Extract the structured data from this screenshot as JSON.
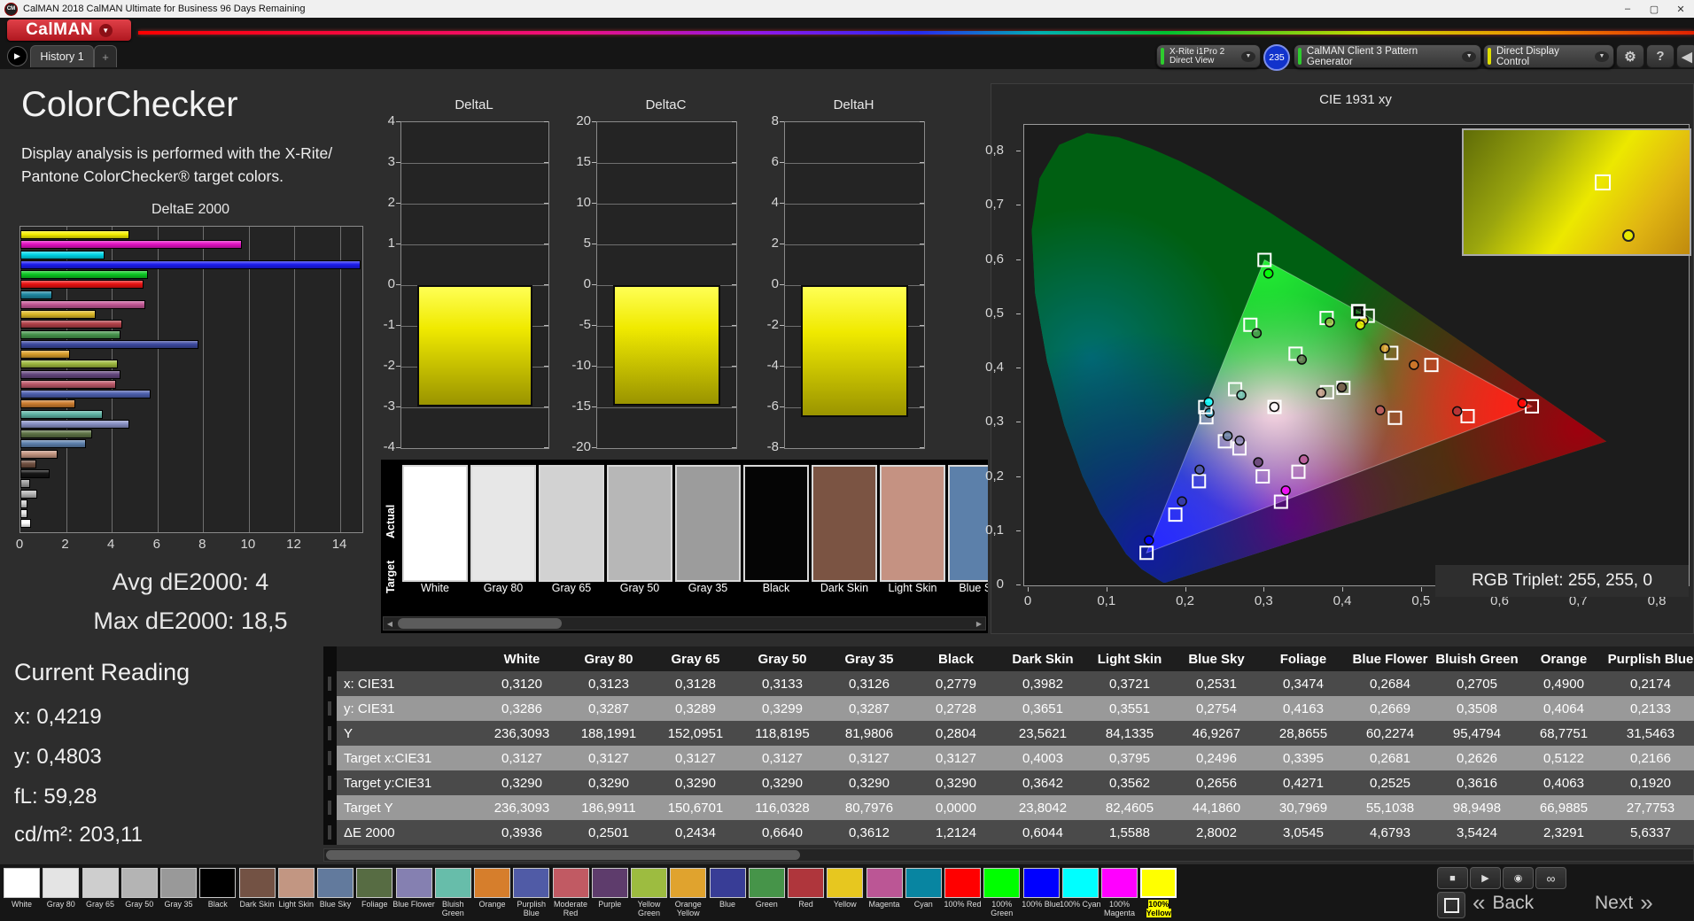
{
  "window": {
    "title": "CalMAN 2018 CalMAN Ultimate for Business 96 Days Remaining",
    "app_icon_text": "CM",
    "controls": {
      "minimize": "–",
      "maximize": "▢",
      "close": "✕"
    }
  },
  "branding": {
    "logo_text": "CalMAN",
    "logo_color": "#c01820"
  },
  "icons": {
    "play": "▶",
    "gear": "⚙",
    "collapse": "◀",
    "chevron_down": "▼",
    "plus": "+",
    "stop": "■",
    "measure": "◉",
    "infinity": "∞",
    "back_chevron": "«",
    "next_chevron": "»",
    "scroll_left": "◀",
    "scroll_right": "▶"
  },
  "tabs": {
    "history_tab": "History 1",
    "add_tab": "+"
  },
  "toolbar": {
    "meter": {
      "line1": "X-Rite i1Pro 2",
      "line2": "Direct View",
      "badge": "235",
      "status_color": "#2ecc2e"
    },
    "source": {
      "label": "CalMAN Client 3 Pattern Generator",
      "status_color": "#2ecc2e"
    },
    "display_control": {
      "label": "Direct Display Control",
      "status_color": "#e0e000"
    },
    "help_label": "?"
  },
  "left_panel": {
    "title": "ColorChecker",
    "description_line1": "Display analysis is performed with the X-Rite/",
    "description_line2": "Pantone ColorChecker® target colors.",
    "avg_label": "Avg dE2000: 4",
    "max_label": "Max dE2000: 18,5",
    "current_reading": {
      "title": "Current Reading",
      "x": "x: 0,4219",
      "y": "y: 0,4803",
      "fl": "fL: 59,28",
      "cdm2": "cd/m²: 203,11"
    }
  },
  "chart_data": [
    {
      "type": "bar",
      "orientation": "horizontal",
      "title": "DeltaE 2000",
      "xlim": [
        0,
        14
      ],
      "x_tick_labels": [
        "0",
        "2",
        "4",
        "6",
        "8",
        "10",
        "12",
        "14"
      ],
      "categories": [
        "100% Yellow",
        "100% Magenta",
        "100% Cyan",
        "100% Blue",
        "100% Green",
        "100% Red",
        "Cyan",
        "Magenta",
        "Yellow",
        "Red",
        "Green",
        "Blue",
        "Orange Yellow",
        "Yellow Green",
        "Purple",
        "Moderate Red",
        "Purplish Blue",
        "Orange",
        "Bluish Green",
        "Blue Flower",
        "Foliage",
        "Blue Sky",
        "Light Skin",
        "Dark Skin",
        "Black",
        "Gray 35",
        "Gray 50",
        "Gray 65",
        "Gray 80",
        "White"
      ],
      "values": [
        4.7,
        9.6,
        3.6,
        18.5,
        5.5,
        5.3,
        1.3,
        5.4,
        3.2,
        4.4,
        4.3,
        7.7,
        2.1,
        4.2,
        4.3,
        4.1,
        5.6337,
        2.3291,
        3.5424,
        4.6793,
        3.0545,
        2.8002,
        1.5588,
        0.6044,
        1.2124,
        0.3612,
        0.664,
        0.2434,
        0.2501,
        0.3936
      ],
      "colors": [
        "#f5ee00",
        "#e311c3",
        "#00d5e8",
        "#1b1bee",
        "#0bc822",
        "#e81111",
        "#1d87a0",
        "#c25795",
        "#dcb927",
        "#b04048",
        "#46954c",
        "#3c49a0",
        "#d89e2b",
        "#9db83e",
        "#64477e",
        "#bb5868",
        "#4d5fae",
        "#cc7c2e",
        "#5fb3a4",
        "#8890c4",
        "#5d7245",
        "#5e81ad",
        "#c29480",
        "#6f4f40",
        "#141414",
        "#9c9c9c",
        "#b5b5b5",
        "#cfcfcf",
        "#e5e5e5",
        "#ffffff"
      ]
    },
    {
      "type": "bar",
      "title": "DeltaL",
      "categories": [
        "100% Yellow"
      ],
      "values": [
        -2.9
      ],
      "ylim": [
        -4,
        4
      ],
      "y_tick_labels": [
        "4",
        "3",
        "2",
        "1",
        "0",
        "-1",
        "-2",
        "-3",
        "-4"
      ],
      "bar_color": "#f0ea00"
    },
    {
      "type": "bar",
      "title": "DeltaC",
      "categories": [
        "100% Yellow"
      ],
      "values": [
        -14.4
      ],
      "ylim": [
        -20,
        20
      ],
      "y_tick_labels": [
        "20",
        "15",
        "10",
        "5",
        "0",
        "-5",
        "-10",
        "-15",
        "-20"
      ],
      "bar_color": "#f0ea00"
    },
    {
      "type": "bar",
      "title": "DeltaH",
      "categories": [
        "100% Yellow"
      ],
      "values": [
        -6.3
      ],
      "ylim": [
        -8,
        8
      ],
      "y_tick_labels": [
        "8",
        "6",
        "4",
        "2",
        "0",
        "-2",
        "-4",
        "-6",
        "-8"
      ],
      "bar_color": "#f0ea00"
    },
    {
      "type": "scatter",
      "title": "CIE 1931 xy",
      "xlim": [
        0,
        0.8
      ],
      "ylim": [
        0,
        0.85
      ],
      "x_tick_labels": [
        "0",
        "0,1",
        "0,2",
        "0,3",
        "0,4",
        "0,5",
        "0,6",
        "0,7",
        "0,8"
      ],
      "y_tick_labels": [
        "0",
        "0,1",
        "0,2",
        "0,3",
        "0,4",
        "0,5",
        "0,6",
        "0,7",
        "0,8"
      ],
      "rgb_triplet": "RGB Triplet: 255, 255, 0",
      "gamut_triangle": {
        "red": [
          0.64,
          0.33
        ],
        "green": [
          0.3,
          0.6
        ],
        "blue": [
          0.15,
          0.06
        ]
      },
      "selected": "100% Yellow",
      "patches": [
        {
          "name": "White/Grays",
          "color": "#ffffff",
          "target": [
            0.3127,
            0.329
          ],
          "measured": [
            0.3125,
            0.329
          ]
        },
        {
          "name": "Dark Skin",
          "color": "#735244",
          "target": [
            0.4003,
            0.3642
          ],
          "measured": [
            0.3982,
            0.3651
          ]
        },
        {
          "name": "Light Skin",
          "color": "#c29682",
          "target": [
            0.3795,
            0.3562
          ],
          "measured": [
            0.3721,
            0.3551
          ]
        },
        {
          "name": "Blue Sky",
          "color": "#627a9d",
          "target": [
            0.2496,
            0.2656
          ],
          "measured": [
            0.2531,
            0.2754
          ]
        },
        {
          "name": "Foliage",
          "color": "#576c43",
          "target": [
            0.3395,
            0.4271
          ],
          "measured": [
            0.3474,
            0.4163
          ]
        },
        {
          "name": "Blue Flower",
          "color": "#8580b1",
          "target": [
            0.2681,
            0.2525
          ],
          "measured": [
            0.2684,
            0.2669
          ]
        },
        {
          "name": "Bluish Green",
          "color": "#67bdaa",
          "target": [
            0.2626,
            0.3616
          ],
          "measured": [
            0.2705,
            0.3508
          ]
        },
        {
          "name": "Orange",
          "color": "#d67e2c",
          "target": [
            0.5122,
            0.4063
          ],
          "measured": [
            0.49,
            0.4064
          ]
        },
        {
          "name": "Purplish Blue",
          "color": "#505ba6",
          "target": [
            0.2166,
            0.192
          ],
          "measured": [
            0.2174,
            0.2133
          ]
        },
        {
          "name": "Moderate Red",
          "color": "#c15a63",
          "target": [
            0.4658,
            0.3089
          ],
          "measured": [
            0.4472,
            0.3229
          ]
        },
        {
          "name": "Purple",
          "color": "#5e3c6c",
          "target": [
            0.2977,
            0.2009
          ],
          "measured": [
            0.292,
            0.227
          ]
        },
        {
          "name": "Yellow Green",
          "color": "#9dbc40",
          "target": [
            0.379,
            0.4929
          ],
          "measured": [
            0.383,
            0.485
          ]
        },
        {
          "name": "Orange Yellow",
          "color": "#e0a32e",
          "target": [
            0.4612,
            0.4286
          ],
          "measured": [
            0.453,
            0.437
          ]
        },
        {
          "name": "Blue",
          "color": "#383d96",
          "target": [
            0.1866,
            0.1304
          ],
          "measured": [
            0.195,
            0.155
          ]
        },
        {
          "name": "Green",
          "color": "#469449",
          "target": [
            0.282,
            0.4804
          ],
          "measured": [
            0.29,
            0.465
          ]
        },
        {
          "name": "Red",
          "color": "#af363c",
          "target": [
            0.5583,
            0.3119
          ],
          "measured": [
            0.545,
            0.321
          ]
        },
        {
          "name": "Yellow",
          "color": "#e7c71f",
          "target": [
            0.4313,
            0.497
          ],
          "measured": [
            0.426,
            0.489
          ]
        },
        {
          "name": "Magenta",
          "color": "#bb5695",
          "target": [
            0.3431,
            0.2095
          ],
          "measured": [
            0.35,
            0.232
          ]
        },
        {
          "name": "Cyan",
          "color": "#0885a1",
          "target": [
            0.2261,
            0.3099
          ],
          "measured": [
            0.23,
            0.318
          ]
        },
        {
          "name": "100% Red",
          "color": "#ff0000",
          "target": [
            0.64,
            0.33
          ],
          "measured": [
            0.628,
            0.336
          ]
        },
        {
          "name": "100% Green",
          "color": "#00ff00",
          "target": [
            0.3,
            0.6
          ],
          "measured": [
            0.305,
            0.575
          ]
        },
        {
          "name": "100% Blue",
          "color": "#0000ff",
          "target": [
            0.15,
            0.06
          ],
          "measured": [
            0.153,
            0.083
          ]
        },
        {
          "name": "100% Cyan",
          "color": "#00ffff",
          "target": [
            0.2246,
            0.3287
          ],
          "measured": [
            0.229,
            0.338
          ]
        },
        {
          "name": "100% Magenta",
          "color": "#ff00ff",
          "target": [
            0.3209,
            0.1542
          ],
          "measured": [
            0.327,
            0.175
          ]
        },
        {
          "name": "100% Yellow",
          "color": "#ffff00",
          "target": [
            0.4193,
            0.5053
          ],
          "measured": [
            0.4219,
            0.4803
          ]
        }
      ]
    }
  ],
  "swatch_strip": {
    "actual_label": "Actual",
    "target_label": "Target",
    "patches": [
      {
        "name": "White",
        "color": "#ffffff"
      },
      {
        "name": "Gray 80",
        "color": "#e7e7e7"
      },
      {
        "name": "Gray 65",
        "color": "#d2d2d2"
      },
      {
        "name": "Gray 50",
        "color": "#b7b7b7"
      },
      {
        "name": "Gray 35",
        "color": "#9c9c9c"
      },
      {
        "name": "Black",
        "color": "#050505"
      },
      {
        "name": "Dark Skin",
        "color": "#7b5443"
      },
      {
        "name": "Light Skin",
        "color": "#c59282"
      },
      {
        "name": "Blue Sky",
        "color": "#5c80aa"
      }
    ]
  },
  "table": {
    "columns": [
      "White",
      "Gray 80",
      "Gray 65",
      "Gray 50",
      "Gray 35",
      "Black",
      "Dark Skin",
      "Light Skin",
      "Blue Sky",
      "Foliage",
      "Blue Flower",
      "Bluish Green",
      "Orange",
      "Purplish Blue"
    ],
    "rows": [
      {
        "label": "x: CIE31",
        "values": [
          "0,3120",
          "0,3123",
          "0,3128",
          "0,3133",
          "0,3126",
          "0,2779",
          "0,3982",
          "0,3721",
          "0,2531",
          "0,3474",
          "0,2684",
          "0,2705",
          "0,4900",
          "0,2174"
        ]
      },
      {
        "label": "y: CIE31",
        "values": [
          "0,3286",
          "0,3287",
          "0,3289",
          "0,3299",
          "0,3287",
          "0,2728",
          "0,3651",
          "0,3551",
          "0,2754",
          "0,4163",
          "0,2669",
          "0,3508",
          "0,4064",
          "0,2133"
        ]
      },
      {
        "label": "Y",
        "values": [
          "236,3093",
          "188,1991",
          "152,0951",
          "118,8195",
          "81,9806",
          "0,2804",
          "23,5621",
          "84,1335",
          "46,9267",
          "28,8655",
          "60,2274",
          "95,4794",
          "68,7751",
          "31,5463"
        ]
      },
      {
        "label": "Target x:CIE31",
        "values": [
          "0,3127",
          "0,3127",
          "0,3127",
          "0,3127",
          "0,3127",
          "0,3127",
          "0,4003",
          "0,3795",
          "0,2496",
          "0,3395",
          "0,2681",
          "0,2626",
          "0,5122",
          "0,2166"
        ]
      },
      {
        "label": "Target y:CIE31",
        "values": [
          "0,3290",
          "0,3290",
          "0,3290",
          "0,3290",
          "0,3290",
          "0,3290",
          "0,3642",
          "0,3562",
          "0,2656",
          "0,4271",
          "0,2525",
          "0,3616",
          "0,4063",
          "0,1920"
        ]
      },
      {
        "label": "Target Y",
        "values": [
          "236,3093",
          "186,9911",
          "150,6701",
          "116,0328",
          "80,7976",
          "0,0000",
          "23,8042",
          "82,4605",
          "44,1860",
          "30,7969",
          "55,1038",
          "98,9498",
          "66,9885",
          "27,7753"
        ]
      },
      {
        "label": "ΔE 2000",
        "values": [
          "0,3936",
          "0,2501",
          "0,2434",
          "0,6640",
          "0,3612",
          "1,2124",
          "0,6044",
          "1,5588",
          "2,8002",
          "3,0545",
          "4,6793",
          "3,5424",
          "2,3291",
          "5,6337"
        ]
      }
    ]
  },
  "bottom_bar": {
    "selected": "100% Yellow",
    "patches": [
      {
        "name": "White",
        "color": "#ffffff"
      },
      {
        "name": "Gray 80",
        "color": "#e4e4e4"
      },
      {
        "name": "Gray 65",
        "color": "#cecece"
      },
      {
        "name": "Gray 50",
        "color": "#b4b4b4"
      },
      {
        "name": "Gray 35",
        "color": "#999999"
      },
      {
        "name": "Black",
        "color": "#000000"
      },
      {
        "name": "Dark Skin",
        "color": "#735244"
      },
      {
        "name": "Light Skin",
        "color": "#c29682"
      },
      {
        "name": "Blue Sky",
        "color": "#627a9d"
      },
      {
        "name": "Foliage",
        "color": "#576c43"
      },
      {
        "name": "Blue Flower",
        "color": "#8580b1"
      },
      {
        "name": "Bluish Green",
        "color": "#67bdaa"
      },
      {
        "name": "Orange",
        "color": "#d67e2c"
      },
      {
        "name": "Purplish Blue",
        "color": "#505ba6"
      },
      {
        "name": "Moderate Red",
        "color": "#c15a63"
      },
      {
        "name": "Purple",
        "color": "#5e3c6c"
      },
      {
        "name": "Yellow Green",
        "color": "#9dbc40"
      },
      {
        "name": "Orange Yellow",
        "color": "#e0a32e"
      },
      {
        "name": "Blue",
        "color": "#383d96"
      },
      {
        "name": "Green",
        "color": "#469449"
      },
      {
        "name": "Red",
        "color": "#af363c"
      },
      {
        "name": "Yellow",
        "color": "#e7c71f"
      },
      {
        "name": "Magenta",
        "color": "#bb5695"
      },
      {
        "name": "Cyan",
        "color": "#0885a1"
      },
      {
        "name": "100% Red",
        "color": "#ff0000"
      },
      {
        "name": "100% Green",
        "color": "#00ff00"
      },
      {
        "name": "100% Blue",
        "color": "#0000ff"
      },
      {
        "name": "100% Cyan",
        "color": "#00ffff"
      },
      {
        "name": "100% Magenta",
        "color": "#ff00ff"
      },
      {
        "name": "100% Yellow",
        "color": "#ffff00"
      }
    ],
    "nav": {
      "back": "Back",
      "next": "Next"
    }
  }
}
